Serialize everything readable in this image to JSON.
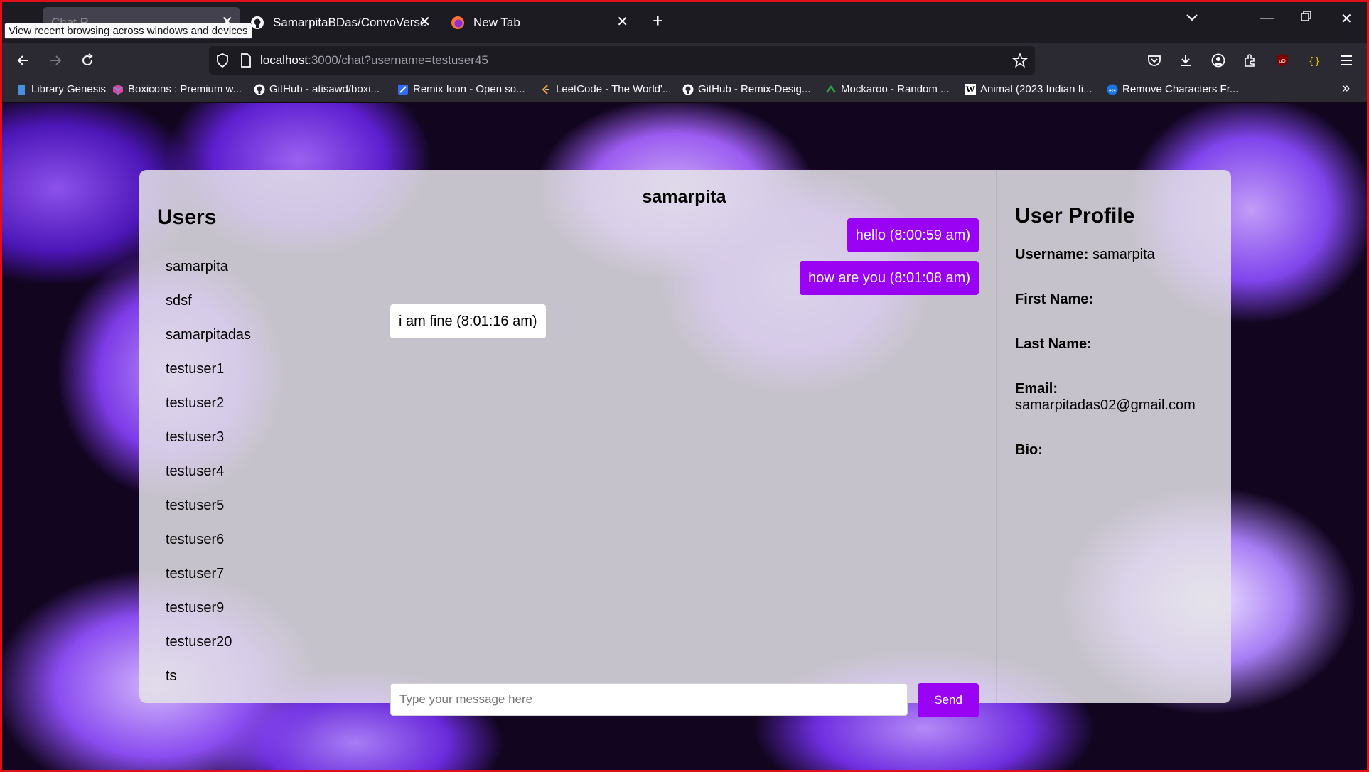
{
  "browser": {
    "tooltip": "View recent browsing across windows and devices",
    "tabs": [
      {
        "title": "Chat R..."
      },
      {
        "title": "SamarpitaBDas/ConvoVerse"
      },
      {
        "title": "New Tab"
      }
    ],
    "url_host": "localhost",
    "url_rest": ":3000/chat?username=testuser45",
    "bookmarks": [
      {
        "label": "Library Genesis",
        "icon": "book-icon",
        "color": "#4a90e2"
      },
      {
        "label": "Boxicons : Premium w...",
        "icon": "cube-icon",
        "color": "#e040a0"
      },
      {
        "label": "GitHub - atisawd/boxi...",
        "icon": "github-icon",
        "color": "#ffffff"
      },
      {
        "label": "Remix Icon - Open so...",
        "icon": "remix-icon",
        "color": "#2f6bff"
      },
      {
        "label": "LeetCode - The World'...",
        "icon": "leetcode-icon",
        "color": "#f0a030"
      },
      {
        "label": "GitHub - Remix-Desig...",
        "icon": "github-icon",
        "color": "#ffffff"
      },
      {
        "label": "Mockaroo - Random ...",
        "icon": "mockaroo-icon",
        "color": "#2ea043"
      },
      {
        "label": "Animal (2023 Indian fi...",
        "icon": "wikipedia-icon",
        "color": "#ffffff"
      },
      {
        "label": "Remove Characters Fr...",
        "icon": "occ-icon",
        "color": "#1a73e8"
      }
    ]
  },
  "users_panel": {
    "title": "Users",
    "users": [
      "samarpita",
      "sdsf",
      "samarpitadas",
      "testuser1",
      "testuser2",
      "testuser3",
      "testuser4",
      "testuser5",
      "testuser6",
      "testuser7",
      "testuser9",
      "testuser20",
      "ts"
    ]
  },
  "chat": {
    "header": "samarpita",
    "messages": [
      {
        "text": "hello (8:00:59 am)",
        "direction": "sent"
      },
      {
        "text": "how are you (8:01:08 am)",
        "direction": "sent"
      },
      {
        "text": "i am fine (8:01:16 am)",
        "direction": "received"
      }
    ],
    "input_placeholder": "Type your message here",
    "input_value": "",
    "send_label": "Send",
    "accent_color": "#9a02f4"
  },
  "profile": {
    "title": "User Profile",
    "username_label": "Username:",
    "username_value": "samarpita",
    "first_name_label": "First Name:",
    "first_name_value": "",
    "last_name_label": "Last Name:",
    "last_name_value": "",
    "email_label": "Email:",
    "email_value": "samarpitadas02@gmail.com",
    "bio_label": "Bio:",
    "bio_value": ""
  }
}
